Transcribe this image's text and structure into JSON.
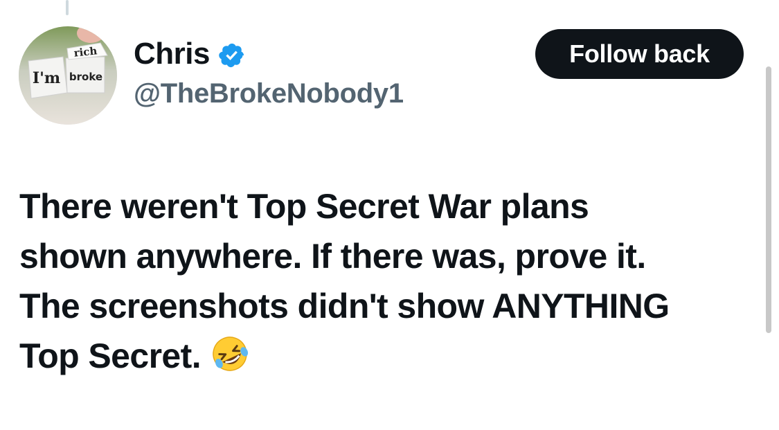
{
  "post": {
    "author": {
      "display_name": "Chris",
      "handle": "@TheBrokeNobody1",
      "verified": true,
      "avatar": {
        "dice_top_text": "rich",
        "dice_left_text": "I'm",
        "dice_right_text": "broke"
      }
    },
    "follow_button_label": "Follow back",
    "text_lines": [
      "There weren't Top Secret War plans",
      "shown anywhere. If there was, prove it.",
      "The screenshots didn't show ANYTHING",
      "Top Secret."
    ],
    "emoji": "rolling-on-the-floor-laughing-icon"
  },
  "colors": {
    "text_primary": "#0f1419",
    "text_secondary": "#536471",
    "verified_blue": "#1d9bf0",
    "button_bg": "#0f1419",
    "button_text": "#ffffff"
  }
}
